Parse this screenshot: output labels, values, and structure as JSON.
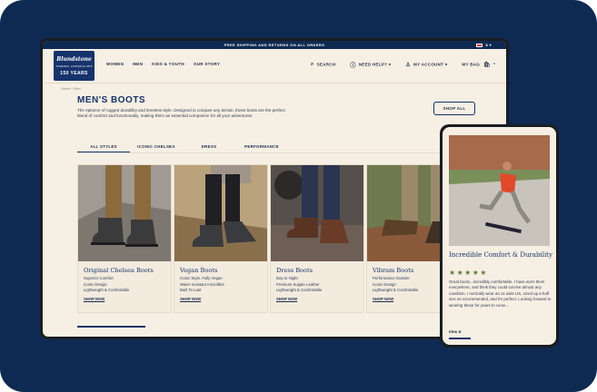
{
  "promo": {
    "text": "FREE SHIPPING AND RETURNS ON ALL ORDERS",
    "currency": "$"
  },
  "logo": {
    "brand": "Blundstone",
    "tagline": "TASMANIA, AUSTRALIA 1870",
    "anniv": "150 YEARS"
  },
  "nav": {
    "items": [
      "WOMEN",
      "MEN",
      "KIDS & YOUTH",
      "OUR STORY"
    ]
  },
  "utility": {
    "search": "SEARCH",
    "help": "NEED HELP?",
    "account": "MY ACCOUNT",
    "bag": "MY BAG",
    "bag_count": "0"
  },
  "breadcrumb": {
    "home": "Home",
    "sep": "/",
    "current": "Men"
  },
  "page": {
    "title": "MEN'S BOOTS",
    "description": "The epitome of rugged durability and timeless style. Designed to conquer any terrain, these boots are the perfect blend of comfort and functionality, making them an essential companion for all your adventures.",
    "shop_all": "SHOP ALL"
  },
  "tabs": [
    "ALL STYLES",
    "ICONIC CHELSEA",
    "DRESS",
    "PERFORMANCE"
  ],
  "cards": [
    {
      "title": "Original Chelsea Boots",
      "lines": [
        "Superior Comfort",
        "Iconic Design",
        "Lightweight & Comfortable"
      ],
      "cta": "SHOP NOW"
    },
    {
      "title": "Vegan Boots",
      "lines": [
        "Iconic Style, Fully Vegan",
        "Water-resistant microfibre",
        "Built To Last"
      ],
      "cta": "SHOP NOW"
    },
    {
      "title": "Dress Boots",
      "lines": [
        "Day to Night",
        "Premium Supple Leather",
        "Lightweight & Comfortable"
      ],
      "cta": "SHOP NOW"
    },
    {
      "title": "Vibram Boots",
      "lines": [
        "Performance Outsole",
        "Iconic Design",
        "Lightweight & Comfortable"
      ],
      "cta": "SHOP NOW"
    }
  ],
  "phone": {
    "title": "Incredible Comfort & Durability",
    "stars": "★★★★★",
    "rating": 5,
    "review": "Great boots...incredibly comfortable. I have worn them everywhere, and think they could survive almost any condition. I normally wear an 11 wide US, sized up a half size as recommended, and it's perfect. Looking forward to wearing these for years to come...",
    "author": "ERIK B"
  },
  "colors": {
    "navy": "#0e2a52",
    "cream": "#f6efe3",
    "star": "#5d7d3b"
  }
}
